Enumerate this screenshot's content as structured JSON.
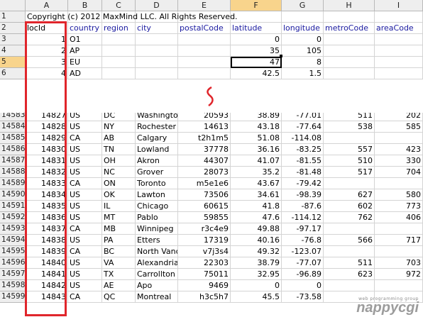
{
  "columns": [
    "A",
    "B",
    "C",
    "D",
    "E",
    "F",
    "G",
    "H",
    "I"
  ],
  "selected_column": "F",
  "selected_row": "5",
  "top_rows": [
    {
      "n": "1",
      "copyright": "Copyright (c) 2012 MaxMind LLC.  All Rights Reserved."
    },
    {
      "n": "2",
      "cells": [
        "locId",
        "country",
        "region",
        "city",
        "postalCode",
        "latitude",
        "longitude",
        "metroCode",
        "areaCode"
      ]
    },
    {
      "n": "3",
      "cells": [
        "1",
        "O1",
        "",
        "",
        "",
        "0",
        "0",
        "",
        ""
      ]
    },
    {
      "n": "4",
      "cells": [
        "2",
        "AP",
        "",
        "",
        "",
        "35",
        "105",
        "",
        ""
      ]
    },
    {
      "n": "5",
      "cells": [
        "3",
        "EU",
        "",
        "",
        "",
        "47",
        "8",
        "",
        ""
      ]
    },
    {
      "n": "6",
      "cells": [
        "4",
        "AD",
        "",
        "",
        "",
        "42.5",
        "1.5",
        "",
        ""
      ]
    }
  ],
  "bottom_rows": [
    {
      "n": "14583",
      "cells": [
        "14827",
        "US",
        "DC",
        "Washington",
        "20593",
        "38.89",
        "-77.01",
        "511",
        "202"
      ]
    },
    {
      "n": "14584",
      "cells": [
        "14828",
        "US",
        "NY",
        "Rochester",
        "14613",
        "43.18",
        "-77.64",
        "538",
        "585"
      ]
    },
    {
      "n": "14585",
      "cells": [
        "14829",
        "CA",
        "AB",
        "Calgary",
        "t2h1m5",
        "51.08",
        "-114.08",
        "",
        ""
      ]
    },
    {
      "n": "14586",
      "cells": [
        "14830",
        "US",
        "TN",
        "Lowland",
        "37778",
        "36.16",
        "-83.25",
        "557",
        "423"
      ]
    },
    {
      "n": "14587",
      "cells": [
        "14831",
        "US",
        "OH",
        "Akron",
        "44307",
        "41.07",
        "-81.55",
        "510",
        "330"
      ]
    },
    {
      "n": "14588",
      "cells": [
        "14832",
        "US",
        "NC",
        "Grover",
        "28073",
        "35.2",
        "-81.48",
        "517",
        "704"
      ]
    },
    {
      "n": "14589",
      "cells": [
        "14833",
        "CA",
        "ON",
        "Toronto",
        "m5e1e6",
        "43.67",
        "-79.42",
        "",
        ""
      ]
    },
    {
      "n": "14590",
      "cells": [
        "14834",
        "US",
        "OK",
        "Lawton",
        "73506",
        "34.61",
        "-98.39",
        "627",
        "580"
      ]
    },
    {
      "n": "14591",
      "cells": [
        "14835",
        "US",
        "IL",
        "Chicago",
        "60615",
        "41.8",
        "-87.6",
        "602",
        "773"
      ]
    },
    {
      "n": "14592",
      "cells": [
        "14836",
        "US",
        "MT",
        "Pablo",
        "59855",
        "47.6",
        "-114.12",
        "762",
        "406"
      ]
    },
    {
      "n": "14593",
      "cells": [
        "14837",
        "CA",
        "MB",
        "Winnipeg",
        "r3c4e9",
        "49.88",
        "-97.17",
        "",
        ""
      ]
    },
    {
      "n": "14594",
      "cells": [
        "14838",
        "US",
        "PA",
        "Etters",
        "17319",
        "40.16",
        "-76.8",
        "566",
        "717"
      ]
    },
    {
      "n": "14595",
      "cells": [
        "14839",
        "CA",
        "BC",
        "North Vancouver",
        "v7j3s4",
        "49.32",
        "-123.07",
        "",
        ""
      ]
    },
    {
      "n": "14596",
      "cells": [
        "14840",
        "US",
        "VA",
        "Alexandria",
        "22303",
        "38.79",
        "-77.07",
        "511",
        "703"
      ]
    },
    {
      "n": "14597",
      "cells": [
        "14841",
        "US",
        "TX",
        "Carrollton",
        "75011",
        "32.95",
        "-96.89",
        "623",
        "972"
      ]
    },
    {
      "n": "14598",
      "cells": [
        "14842",
        "US",
        "AE",
        "Apo",
        "9469",
        "0",
        "0",
        "",
        ""
      ]
    },
    {
      "n": "14599",
      "cells": [
        "14843",
        "CA",
        "QC",
        "Montreal",
        "h3c5h7",
        "45.5",
        "-73.58",
        "",
        ""
      ]
    }
  ],
  "watermark": {
    "small": "web programming group",
    "big": "nappycgi"
  },
  "colors": {
    "highlight": "#e0252b",
    "selected_header": "#f8d48c",
    "header_bg": "#eeeeee"
  }
}
